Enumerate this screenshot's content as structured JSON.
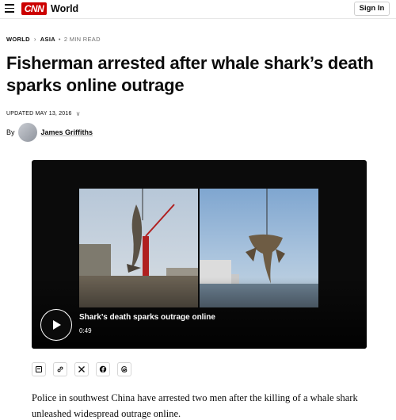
{
  "header": {
    "logo_text": "CNN",
    "section": "World",
    "signin_label": "Sign In"
  },
  "breadcrumb": {
    "items": [
      "WORLD",
      "ASIA"
    ],
    "read_time": "2 MIN READ"
  },
  "article": {
    "headline": "Fisherman arrested after whale shark’s death sparks online outrage",
    "updated": "UPDATED MAY 13, 2016",
    "by_label": "By",
    "author": "James Griffiths"
  },
  "video": {
    "title": "Shark’s death sparks outrage online",
    "duration": "0:49"
  },
  "share": {
    "icons": [
      "bookmark-icon",
      "link-icon",
      "x-icon",
      "facebook-icon",
      "threads-icon"
    ]
  },
  "body": {
    "paragraph_1": "Police in southwest China have arrested two men after the killing of a whale shark unleashed widespread outrage online."
  },
  "colors": {
    "brand": "#cc0000",
    "text": "#0c0c0c",
    "muted": "#6e6e6e",
    "video_bg": "#0b0b0b"
  }
}
